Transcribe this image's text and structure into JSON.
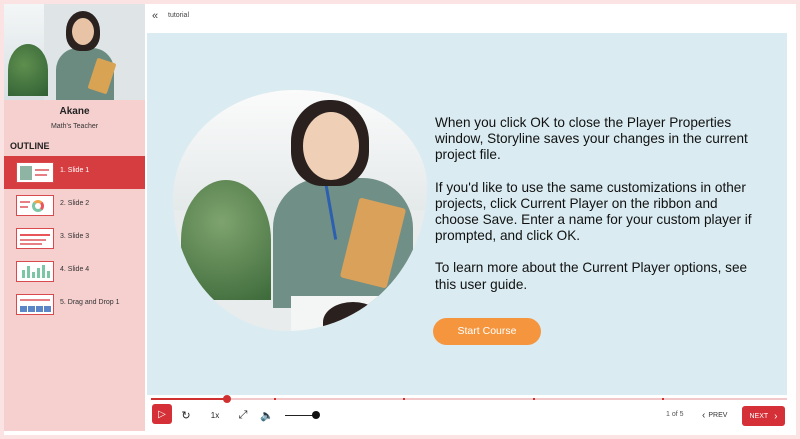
{
  "presenter": {
    "name": "Akane",
    "title": "Math's Teacher"
  },
  "outline": {
    "title": "OUTLINE",
    "items": [
      {
        "label": "1. Slide 1",
        "active": true
      },
      {
        "label": "2. Slide 2",
        "active": false
      },
      {
        "label": "3. Slide 3",
        "active": false
      },
      {
        "label": "4. Slide 4",
        "active": false
      },
      {
        "label": "5. Drag and Drop 1",
        "active": false
      }
    ]
  },
  "topbar": {
    "back_icon": "double-chevron-left-icon",
    "label": "tutorial"
  },
  "slide": {
    "paragraphs": [
      "When you click OK to close the Player Properties window, Storyline saves your changes in the current project file.",
      "If you'd like to use the same customizations in other projects, click Current Player on the ribbon and choose Save. Enter a name for your custom player if prompted, and click OK.",
      "To learn more about the Current Player options, see this user guide."
    ],
    "button_label": "Start Course"
  },
  "controls": {
    "speed_label": "1x",
    "page_count": "1 of 5",
    "prev_label": "PREV",
    "next_label": "NEXT",
    "progress_fraction": 0.12,
    "volume_fraction": 0.9
  },
  "colors": {
    "accent": "#d53037",
    "sidebar_bg": "#f6cfcf",
    "slide_bg": "#daecf2",
    "button": "#f5963f"
  }
}
